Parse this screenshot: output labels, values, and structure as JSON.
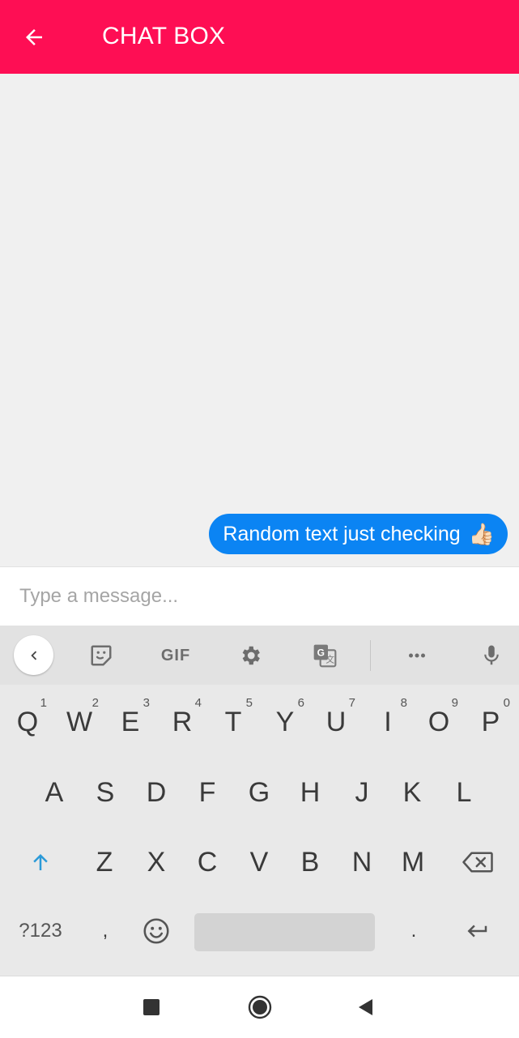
{
  "app": {
    "title": "CHAT BOX",
    "accent": "#fe0e54"
  },
  "icons": {
    "back": "arrow-left-icon",
    "thumbs_up": "thumbs-up-emoji"
  },
  "messages": [
    {
      "text": "Random text just checking",
      "emoji": "👍🏻",
      "side": "outgoing",
      "color": "#0b84f3"
    }
  ],
  "composer": {
    "placeholder": "Type a message...",
    "value": ""
  },
  "keyboard": {
    "toolbar": {
      "gif_label": "GIF",
      "items": [
        "collapse-chevron-icon",
        "sticker-icon",
        "gif",
        "settings-gear-icon",
        "translate-icon",
        "more-dots-icon",
        "microphone-icon"
      ]
    },
    "row1": [
      {
        "label": "Q",
        "hint": "1"
      },
      {
        "label": "W",
        "hint": "2"
      },
      {
        "label": "E",
        "hint": "3"
      },
      {
        "label": "R",
        "hint": "4"
      },
      {
        "label": "T",
        "hint": "5"
      },
      {
        "label": "Y",
        "hint": "6"
      },
      {
        "label": "U",
        "hint": "7"
      },
      {
        "label": "I",
        "hint": "8"
      },
      {
        "label": "O",
        "hint": "9"
      },
      {
        "label": "P",
        "hint": "0"
      }
    ],
    "row2": [
      "A",
      "S",
      "D",
      "F",
      "G",
      "H",
      "J",
      "K",
      "L"
    ],
    "row3": [
      "Z",
      "X",
      "C",
      "V",
      "B",
      "N",
      "M"
    ],
    "row4": {
      "symbols_label": "?123",
      "comma": ",",
      "period": "."
    }
  },
  "navbar": {
    "items": [
      "recents-square-icon",
      "home-circle-icon",
      "back-triangle-icon"
    ]
  }
}
